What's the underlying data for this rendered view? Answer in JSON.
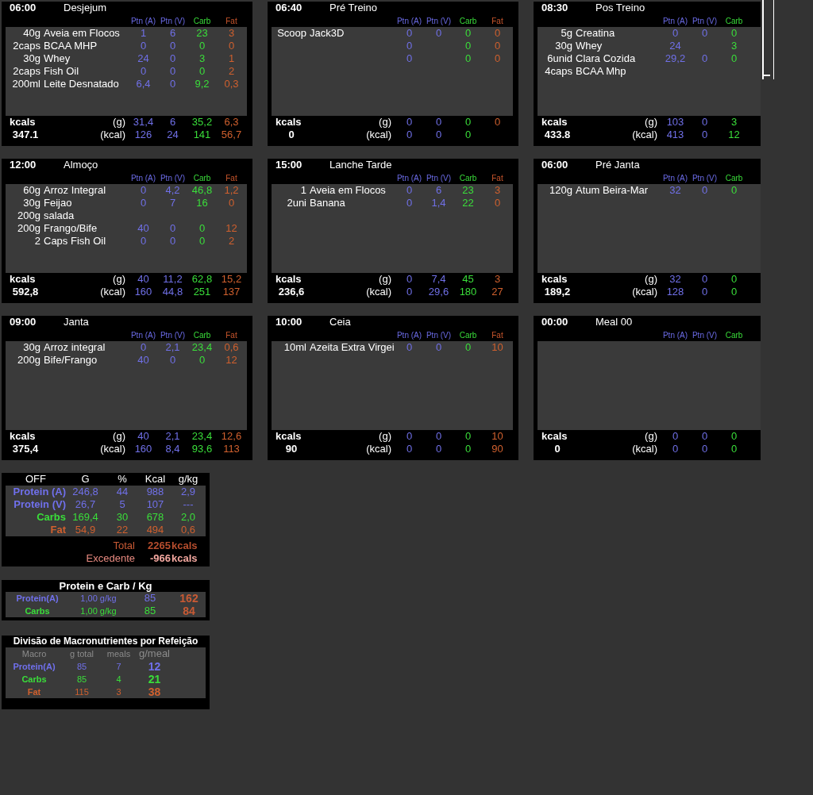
{
  "meals": [
    {
      "time": "06:00",
      "name": "Desjejum",
      "columns": [
        {
          "label": "Ptn (A)",
          "kind": "ptn_a"
        },
        {
          "label": "Ptn (V)",
          "kind": "ptn_v"
        },
        {
          "label": "Carb",
          "kind": "carb"
        },
        {
          "label": "Fat",
          "kind": "fat"
        }
      ],
      "items": [
        {
          "qty": "40g",
          "name": "Aveia em Flocos",
          "values": [
            {
              "kind": "ptn_a",
              "text": "1"
            },
            {
              "kind": "ptn_v",
              "text": "6"
            },
            {
              "kind": "carb",
              "text": "23"
            },
            {
              "kind": "fat",
              "text": "3"
            }
          ]
        },
        {
          "qty": "2caps",
          "name": "BCAA MHP",
          "values": [
            {
              "kind": "ptn_a",
              "text": "0"
            },
            {
              "kind": "ptn_v",
              "text": "0"
            },
            {
              "kind": "carb",
              "text": "0"
            },
            {
              "kind": "fat",
              "text": "0"
            }
          ]
        },
        {
          "qty": "30g",
          "name": "Whey",
          "values": [
            {
              "kind": "ptn_a",
              "text": "24"
            },
            {
              "kind": "ptn_v",
              "text": "0"
            },
            {
              "kind": "carb",
              "text": "3"
            },
            {
              "kind": "fat",
              "text": "1"
            }
          ]
        },
        {
          "qty": "2caps",
          "name": "Fish Oil",
          "values": [
            {
              "kind": "ptn_a",
              "text": "0"
            },
            {
              "kind": "ptn_v",
              "text": "0"
            },
            {
              "kind": "carb",
              "text": "0"
            },
            {
              "kind": "fat",
              "text": "2"
            }
          ]
        },
        {
          "qty": "200ml",
          "name": "Leite Desnatado",
          "values": [
            {
              "kind": "ptn_a",
              "text": "6,4"
            },
            {
              "kind": "ptn_v",
              "text": "0"
            },
            {
              "kind": "carb",
              "text": "9,2"
            },
            {
              "kind": "fat",
              "text": "0,3"
            }
          ]
        }
      ],
      "summary_label": "kcals",
      "total": "347.1",
      "grams": {
        "label": "(g)",
        "values": [
          {
            "kind": "ptn_a",
            "text": "31,4"
          },
          {
            "kind": "ptn_v",
            "text": "6"
          },
          {
            "kind": "carb",
            "text": "35,2"
          },
          {
            "kind": "fat",
            "text": "6,3"
          }
        ]
      },
      "energy": {
        "label": "(kcal)",
        "values": [
          {
            "kind": "ptn_a",
            "text": "126"
          },
          {
            "kind": "ptn_v",
            "text": "24"
          },
          {
            "kind": "carb",
            "text": "141"
          },
          {
            "kind": "fat",
            "text": "56,7"
          }
        ]
      }
    },
    {
      "time": "06:40",
      "name": "Pré Treino",
      "columns": [
        {
          "label": "Ptn (A)",
          "kind": "ptn_a"
        },
        {
          "label": "Ptn (V)",
          "kind": "ptn_v"
        },
        {
          "label": "Carb",
          "kind": "carb"
        },
        {
          "label": "Fat",
          "kind": "fat"
        }
      ],
      "items": [
        {
          "qty": "Scoop",
          "name": "Jack3D",
          "values": [
            {
              "kind": "ptn_a",
              "text": "0"
            },
            {
              "kind": "ptn_v",
              "text": "0"
            },
            {
              "kind": "carb",
              "text": "0"
            },
            {
              "kind": "fat",
              "text": "0"
            }
          ]
        },
        {
          "values": [
            {
              "kind": "ptn_a",
              "text": "0"
            },
            {
              "kind": "carb",
              "text": "0"
            },
            {
              "kind": "fat",
              "text": "0"
            }
          ]
        },
        {
          "values": [
            {
              "kind": "ptn_a",
              "text": "0"
            },
            {
              "kind": "carb",
              "text": "0"
            },
            {
              "kind": "fat",
              "text": "0"
            }
          ]
        }
      ],
      "summary_label": "kcals",
      "total": "0",
      "grams": {
        "label": "(g)",
        "values": [
          {
            "kind": "ptn_a",
            "text": "0"
          },
          {
            "kind": "ptn_v",
            "text": "0"
          },
          {
            "kind": "carb",
            "text": "0"
          },
          {
            "kind": "fat",
            "text": "0"
          }
        ]
      },
      "energy": {
        "label": "(kcal)",
        "values": [
          {
            "kind": "ptn_a",
            "text": "0"
          },
          {
            "kind": "ptn_v",
            "text": "0"
          },
          {
            "kind": "carb",
            "text": "0"
          }
        ]
      }
    },
    {
      "time": "08:30",
      "name": "Pos Treino",
      "columns": [
        {
          "label": "Ptn (A)",
          "kind": "ptn_a"
        },
        {
          "label": "Ptn (V)",
          "kind": "ptn_v"
        },
        {
          "label": "Carb",
          "kind": "carb"
        }
      ],
      "items": [
        {
          "qty": "5g",
          "name": "Creatina",
          "values": [
            {
              "kind": "ptn_a",
              "text": "0"
            },
            {
              "kind": "ptn_v",
              "text": "0"
            },
            {
              "kind": "carb",
              "text": "0"
            }
          ]
        },
        {
          "qty": "30g",
          "name": "Whey",
          "values": [
            {
              "kind": "ptn_a",
              "text": "24"
            },
            {
              "kind": "carb",
              "text": "3"
            }
          ]
        },
        {
          "qty": "6unid",
          "name": "Clara Cozida",
          "values": [
            {
              "kind": "ptn_a",
              "text": "29,2"
            },
            {
              "kind": "ptn_v",
              "text": "0"
            },
            {
              "kind": "carb",
              "text": "0"
            }
          ]
        },
        {
          "qty": "4caps",
          "name": "BCAA Mhp"
        }
      ],
      "summary_label": "kcals",
      "total": "433.8",
      "grams": {
        "label": "(g)",
        "values": [
          {
            "kind": "ptn_a",
            "text": "103"
          },
          {
            "kind": "ptn_v",
            "text": "0"
          },
          {
            "kind": "carb",
            "text": "3"
          }
        ]
      },
      "energy": {
        "label": "(kcal)",
        "values": [
          {
            "kind": "ptn_a",
            "text": "413"
          },
          {
            "kind": "ptn_v",
            "text": "0"
          },
          {
            "kind": "carb",
            "text": "12"
          }
        ]
      }
    },
    {
      "time": "12:00",
      "name": "Almoço",
      "columns": [
        {
          "label": "Ptn (A)",
          "kind": "ptn_a"
        },
        {
          "label": "Ptn (V)",
          "kind": "ptn_v"
        },
        {
          "label": "Carb",
          "kind": "carb"
        },
        {
          "label": "Fat",
          "kind": "fat"
        }
      ],
      "items": [
        {
          "qty": "60g",
          "name": "Arroz Integral",
          "values": [
            {
              "kind": "ptn_a",
              "text": "0"
            },
            {
              "kind": "ptn_v",
              "text": "4,2"
            },
            {
              "kind": "carb",
              "text": "46,8"
            },
            {
              "kind": "fat",
              "text": "1,2"
            }
          ]
        },
        {
          "qty": "30g",
          "name": "Feijao",
          "values": [
            {
              "kind": "ptn_a",
              "text": "0"
            },
            {
              "kind": "ptn_v",
              "text": "7"
            },
            {
              "kind": "carb",
              "text": "16"
            },
            {
              "kind": "fat",
              "text": "0"
            }
          ]
        },
        {
          "qty": "200g",
          "name": "salada"
        },
        {
          "qty": "200g",
          "name": "Frango/Bife",
          "values": [
            {
              "kind": "ptn_a",
              "text": "40"
            },
            {
              "kind": "ptn_v",
              "text": "0"
            },
            {
              "kind": "carb",
              "text": "0"
            },
            {
              "kind": "fat",
              "text": "12"
            }
          ]
        },
        {
          "qty": "2",
          "name": "Caps Fish Oil",
          "values": [
            {
              "kind": "ptn_a",
              "text": "0"
            },
            {
              "kind": "ptn_v",
              "text": "0"
            },
            {
              "kind": "carb",
              "text": "0"
            },
            {
              "kind": "fat",
              "text": "2"
            }
          ]
        }
      ],
      "summary_label": "kcals",
      "total": "592,8",
      "grams": {
        "label": "(g)",
        "values": [
          {
            "kind": "ptn_a",
            "text": "40"
          },
          {
            "kind": "ptn_v",
            "text": "11,2"
          },
          {
            "kind": "carb",
            "text": "62,8"
          },
          {
            "kind": "fat",
            "text": "15,2"
          }
        ]
      },
      "energy": {
        "label": "(kcal)",
        "values": [
          {
            "kind": "ptn_a",
            "text": "160"
          },
          {
            "kind": "ptn_v",
            "text": "44,8"
          },
          {
            "kind": "carb",
            "text": "251"
          },
          {
            "kind": "fat",
            "text": "137"
          }
        ]
      }
    },
    {
      "time": "15:00",
      "name": "Lanche Tarde",
      "columns": [
        {
          "label": "Ptn (A)",
          "kind": "ptn_a"
        },
        {
          "label": "Ptn (V)",
          "kind": "ptn_v"
        },
        {
          "label": "Carb",
          "kind": "carb"
        },
        {
          "label": "Fat",
          "kind": "fat"
        }
      ],
      "items": [
        {
          "qty": "1",
          "name": "Aveia em Flocos",
          "values": [
            {
              "kind": "ptn_a",
              "text": "0"
            },
            {
              "kind": "ptn_v",
              "text": "6"
            },
            {
              "kind": "carb",
              "text": "23"
            },
            {
              "kind": "fat",
              "text": "3"
            }
          ]
        },
        {
          "qty": "2uni",
          "name": "Banana",
          "values": [
            {
              "kind": "ptn_a",
              "text": "0"
            },
            {
              "kind": "ptn_v",
              "text": "1,4"
            },
            {
              "kind": "carb",
              "text": "22"
            },
            {
              "kind": "fat",
              "text": "0"
            }
          ]
        }
      ],
      "summary_label": "kcals",
      "total": "236,6",
      "grams": {
        "label": "(g)",
        "values": [
          {
            "kind": "ptn_a",
            "text": "0"
          },
          {
            "kind": "ptn_v",
            "text": "7,4"
          },
          {
            "kind": "carb",
            "text": "45"
          },
          {
            "kind": "fat",
            "text": "3"
          }
        ]
      },
      "energy": {
        "label": "(kcal)",
        "values": [
          {
            "kind": "ptn_a",
            "text": "0"
          },
          {
            "kind": "ptn_v",
            "text": "29,6"
          },
          {
            "kind": "carb",
            "text": "180"
          },
          {
            "kind": "fat",
            "text": "27"
          }
        ]
      }
    },
    {
      "time": "06:00",
      "name": "Pré Janta",
      "columns": [
        {
          "label": "Ptn (A)",
          "kind": "ptn_a"
        },
        {
          "label": "Ptn (V)",
          "kind": "ptn_v"
        },
        {
          "label": "Carb",
          "kind": "carb"
        }
      ],
      "items": [
        {
          "qty": "120g",
          "name": "Atum Beira-Mar",
          "values": [
            {
              "kind": "ptn_a",
              "text": "32"
            },
            {
              "kind": "ptn_v",
              "text": "0"
            },
            {
              "kind": "carb",
              "text": "0"
            }
          ]
        }
      ],
      "summary_label": "kcals",
      "total": "189,2",
      "grams": {
        "label": "(g)",
        "values": [
          {
            "kind": "ptn_a",
            "text": "32"
          },
          {
            "kind": "ptn_v",
            "text": "0"
          },
          {
            "kind": "carb",
            "text": "0"
          }
        ]
      },
      "energy": {
        "label": "(kcal)",
        "values": [
          {
            "kind": "ptn_a",
            "text": "128"
          },
          {
            "kind": "ptn_v",
            "text": "0"
          },
          {
            "kind": "carb",
            "text": "0"
          }
        ]
      }
    },
    {
      "time": "09:00",
      "name": "Janta",
      "columns": [
        {
          "label": "Ptn (A)",
          "kind": "ptn_a"
        },
        {
          "label": "Ptn (V)",
          "kind": "ptn_v"
        },
        {
          "label": "Carb",
          "kind": "carb"
        },
        {
          "label": "Fat",
          "kind": "fat"
        }
      ],
      "items": [
        {
          "qty": "30g",
          "name": "Arroz integral",
          "values": [
            {
              "kind": "ptn_a",
              "text": "0"
            },
            {
              "kind": "ptn_v",
              "text": "2,1"
            },
            {
              "kind": "carb",
              "text": "23,4"
            },
            {
              "kind": "fat",
              "text": "0,6"
            }
          ]
        },
        {
          "qty": "200g",
          "name": "Bife/Frango",
          "values": [
            {
              "kind": "ptn_a",
              "text": "40"
            },
            {
              "kind": "ptn_v",
              "text": "0"
            },
            {
              "kind": "carb",
              "text": "0"
            },
            {
              "kind": "fat",
              "text": "12"
            }
          ]
        }
      ],
      "summary_label": "kcals",
      "total": "375,4",
      "grams": {
        "label": "(g)",
        "values": [
          {
            "kind": "ptn_a",
            "text": "40"
          },
          {
            "kind": "ptn_v",
            "text": "2,1"
          },
          {
            "kind": "carb",
            "text": "23,4"
          },
          {
            "kind": "fat",
            "text": "12,6"
          }
        ]
      },
      "energy": {
        "label": "(kcal)",
        "values": [
          {
            "kind": "ptn_a",
            "text": "160"
          },
          {
            "kind": "ptn_v",
            "text": "8,4"
          },
          {
            "kind": "carb",
            "text": "93,6"
          },
          {
            "kind": "fat",
            "text": "113"
          }
        ]
      }
    },
    {
      "time": "10:00",
      "name": "Ceia",
      "columns": [
        {
          "label": "Ptn (A)",
          "kind": "ptn_a"
        },
        {
          "label": "Ptn (V)",
          "kind": "ptn_v"
        },
        {
          "label": "Carb",
          "kind": "carb"
        },
        {
          "label": "Fat",
          "kind": "fat"
        }
      ],
      "items": [
        {
          "qty": "10ml",
          "name": "Azeita Extra Virgei",
          "values": [
            {
              "kind": "ptn_a",
              "text": "0"
            },
            {
              "kind": "ptn_v",
              "text": "0"
            },
            {
              "kind": "carb",
              "text": "0"
            },
            {
              "kind": "fat",
              "text": "10"
            }
          ]
        }
      ],
      "summary_label": "kcals",
      "total": "90",
      "grams": {
        "label": "(g)",
        "values": [
          {
            "kind": "ptn_a",
            "text": "0"
          },
          {
            "kind": "ptn_v",
            "text": "0"
          },
          {
            "kind": "carb",
            "text": "0"
          },
          {
            "kind": "fat",
            "text": "10"
          }
        ]
      },
      "energy": {
        "label": "(kcal)",
        "values": [
          {
            "kind": "ptn_a",
            "text": "0"
          },
          {
            "kind": "ptn_v",
            "text": "0"
          },
          {
            "kind": "carb",
            "text": "0"
          },
          {
            "kind": "fat",
            "text": "90"
          }
        ]
      }
    },
    {
      "time": "00:00",
      "name": "Meal 00",
      "columns": [
        {
          "label": "Ptn (A)",
          "kind": "ptn_a"
        },
        {
          "label": "Ptn (V)",
          "kind": "ptn_v"
        },
        {
          "label": "Carb",
          "kind": "carb"
        }
      ],
      "summary_label": "kcals",
      "total": "0",
      "grams": {
        "label": "(g)",
        "values": [
          {
            "kind": "ptn_a",
            "text": "0"
          },
          {
            "kind": "ptn_v",
            "text": "0"
          },
          {
            "kind": "carb",
            "text": "0"
          }
        ]
      },
      "energy": {
        "label": "(kcal)",
        "values": [
          {
            "kind": "ptn_a",
            "text": "0"
          },
          {
            "kind": "ptn_v",
            "text": "0"
          },
          {
            "kind": "carb",
            "text": "0"
          }
        ]
      }
    }
  ],
  "macro_summary": {
    "columns": [
      "OFF",
      "G",
      "%",
      "Kcal",
      "g/kg"
    ],
    "rows": [
      {
        "kind": "protein",
        "label": "Protein (A)",
        "values": [
          "246,8",
          "44",
          "988",
          "2,9"
        ]
      },
      {
        "kind": "protein",
        "label": "Protein (V)",
        "values": [
          "26,7",
          "5",
          "107",
          "---"
        ]
      },
      {
        "kind": "carb",
        "label": "Carbs",
        "values": [
          "169,4",
          "30",
          "678",
          "2,0"
        ]
      },
      {
        "kind": "fat",
        "label": "Fat",
        "values": [
          "54,9",
          "22",
          "494",
          "0,6"
        ]
      }
    ],
    "totals": [
      {
        "kind": "total",
        "label": "Total",
        "value": "2265",
        "unit": "kcals"
      },
      {
        "kind": "surplus",
        "label": "Excedente",
        "value": "-966",
        "unit": "kcals"
      }
    ]
  },
  "per_kg": {
    "title": "Protein e Carb / Kg",
    "rows": [
      {
        "kind": "protein",
        "label": "Protein(A)",
        "ratio": "1,00 g/kg",
        "weight": "85",
        "grams": "162"
      },
      {
        "kind": "carb",
        "label": "Carbs",
        "ratio": "1,00 g/kg",
        "weight": "85",
        "grams": "84"
      }
    ]
  },
  "per_meal": {
    "title": "Divisão de Macronutrientes por Refeição",
    "columns": [
      "Macro",
      "g total",
      "meals",
      "g/meal"
    ],
    "rows": [
      {
        "kind": "protein",
        "label": "Protein(A)",
        "total": "85",
        "meals": "7",
        "per_meal": "12"
      },
      {
        "kind": "carb",
        "label": "Carbs",
        "total": "85",
        "meals": "4",
        "per_meal": "21"
      },
      {
        "kind": "fat",
        "label": "Fat",
        "total": "115",
        "meals": "3",
        "per_meal": "38"
      }
    ]
  }
}
